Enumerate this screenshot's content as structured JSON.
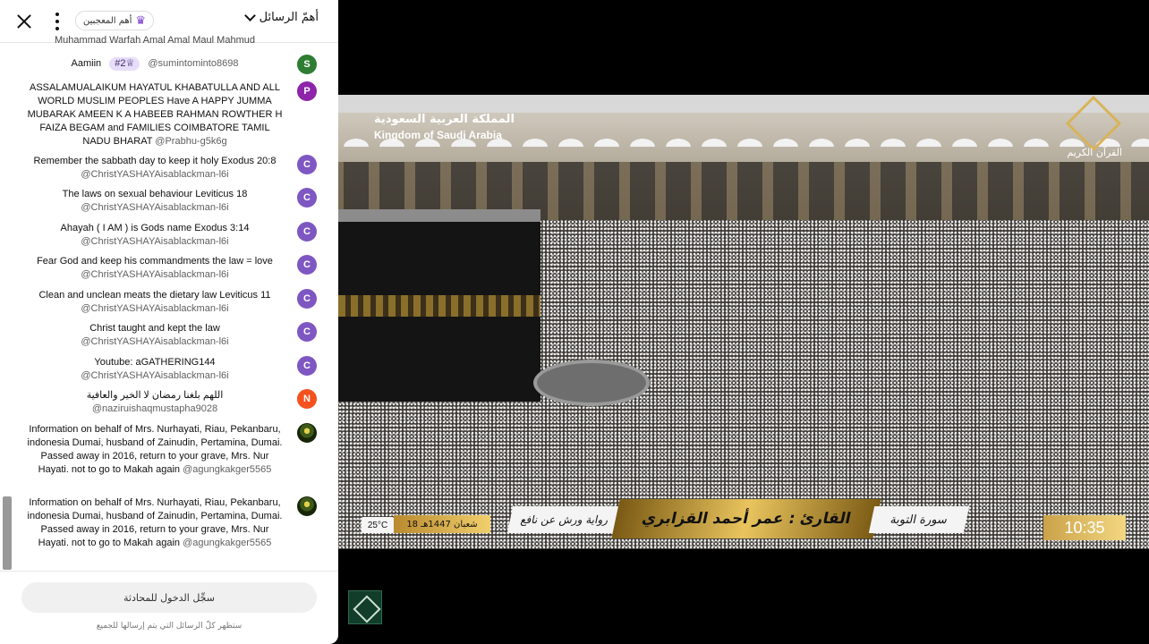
{
  "chat": {
    "header": {
      "title": "أهمّ الرسائل",
      "donors_label": "أهم المعجبين"
    },
    "top_partial": "Muhammad Warfah Amal Amal Maul Mahmud",
    "messages": [
      {
        "author": "@sumintominto8698",
        "text": "Aamiin",
        "avatar": "S",
        "avatar_color": "#2e7d32",
        "badge": "#2♕"
      },
      {
        "author": "@Prabhu-g5k6g",
        "text": "ASSALAMUALAIKUM HAYATUL KHABATULLA AND ALL WORLD MUSLIM PEOPLES Have A HAPPY JUMMA MUBARAK AMEEN K A HABEEB RAHMAN ROWTHER H FAIZA BEGAM and FAMILIES COIMBATORE TAMIL NADU BHARAT",
        "avatar": "P",
        "avatar_color": "#8e24aa"
      },
      {
        "author": "@ChristYASHAYAisablackman-l6i",
        "text": "Remember the sabbath day to keep it holy Exodus 20:8",
        "avatar": "C",
        "avatar_color": "#7e57c2"
      },
      {
        "author": "@ChristYASHAYAisablackman-l6i",
        "text": "The laws on sexual behaviour Leviticus 18",
        "avatar": "C",
        "avatar_color": "#7e57c2"
      },
      {
        "author": "@ChristYASHAYAisablackman-l6i",
        "text": "Ahayah ( I AM ) is Gods name Exodus 3:14",
        "avatar": "C",
        "avatar_color": "#7e57c2"
      },
      {
        "author": "@ChristYASHAYAisablackman-l6i",
        "text": "Fear God and keep his commandments the law = love",
        "avatar": "C",
        "avatar_color": "#7e57c2"
      },
      {
        "author": "@ChristYASHAYAisablackman-l6i",
        "text": "Clean and unclean meats the dietary law Leviticus 11",
        "avatar": "C",
        "avatar_color": "#7e57c2"
      },
      {
        "author": "@ChristYASHAYAisablackman-l6i",
        "text": "Christ taught and kept the law",
        "avatar": "C",
        "avatar_color": "#7e57c2"
      },
      {
        "author": "@ChristYASHAYAisablackman-l6i",
        "text": "Youtube: aGATHERING144",
        "avatar": "C",
        "avatar_color": "#7e57c2"
      },
      {
        "author": "@naziruishaqmustapha9028",
        "text": "اللهم بلغنا رمضان لا الخير والعافية",
        "avatar": "N",
        "avatar_color": "#f4511e"
      },
      {
        "author": "@agungkakger5565",
        "text": "Information on behalf of Mrs. Nurhayati, Riau, Pekanbaru, indonesia Dumai, husband of Zainudin, Pertamina, Dumai. Passed away in 2016, return to your grave, Mrs. Nur Hayati. not to go to Makah again",
        "avatar": "",
        "avatar_color": "#3d5a1a"
      },
      {
        "author": "@agungkakger5565",
        "text": "Information on behalf of Mrs. Nurhayati, Riau, Pekanbaru, indonesia Dumai, husband of Zainudin, Pertamina, Dumai. Passed away in 2016, return to your grave, Mrs. Nur Hayati. not to go to Makah again",
        "avatar": "",
        "avatar_color": "#3d5a1a"
      }
    ],
    "footer": {
      "signin_label": "سجِّل الدخول للمحادثة",
      "note": "ستظهر كلّ الرسائل التي يتم إرسالها للجميع"
    }
  },
  "video": {
    "logo_ar": "المملكة العربية السعودية",
    "logo_en": "Kingdom of Saudi Arabia",
    "channel": "القرآن الكريم",
    "temperature": "25°C",
    "hijri_date": "18 شعبان 1447هـ",
    "riwaya": "رواية ورش عن نافع",
    "qari": "القارئ : عمر أحمد القزابري",
    "surah": "سورة التوبة",
    "time": "10:35"
  }
}
